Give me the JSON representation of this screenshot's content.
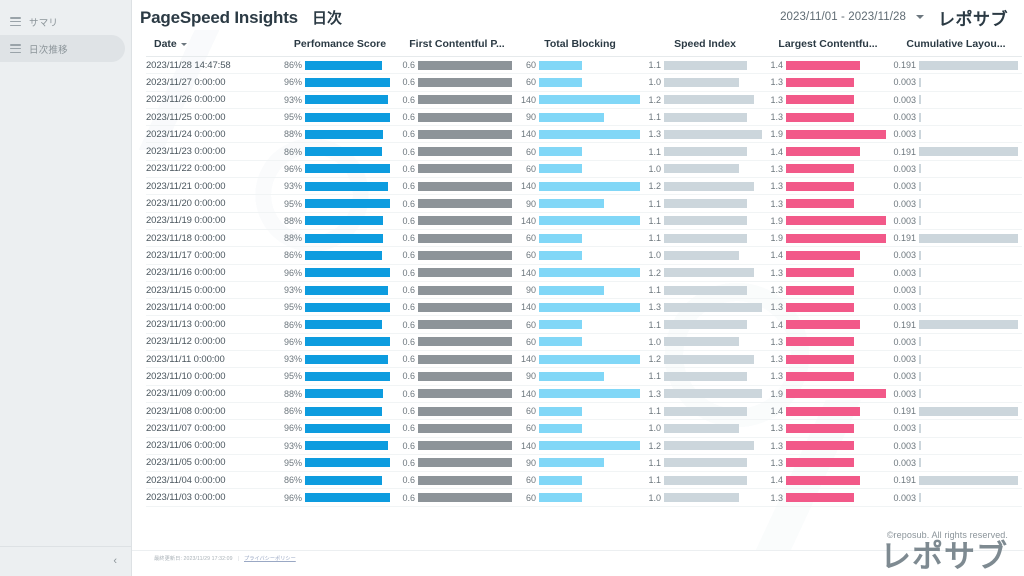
{
  "sidebar": {
    "items": [
      {
        "label": "サマリ",
        "icon": "list-icon",
        "active": false
      },
      {
        "label": "日次推移",
        "icon": "list-icon",
        "active": true
      }
    ],
    "collapse_label": "‹"
  },
  "header": {
    "title": "PageSpeed Insights",
    "subtitle": "日次",
    "date_range": "2023/11/01 - 2023/11/28",
    "brand": "レポサブ"
  },
  "footer": {
    "last_updated": "最終更新日: 2023/11/29 17:32:09",
    "separator": "|",
    "privacy_link": "プライバシーポリシー",
    "copyright": "©reposub. All rights reserved.",
    "brand_big": "レポサブ"
  },
  "colors": {
    "performance_bar": "#0d9cdf",
    "fcp_bar": "#8d9499",
    "tbt_bar": "#81d7f7",
    "speed_index_bar": "#ccd6dc",
    "lcp_bar": "#f25989",
    "cls_bar": "#ccd6dc",
    "sidebar_bg": "#eceff1",
    "sidebar_active": "#dfe3e6",
    "text_dark": "#2b3a44"
  },
  "chart_data": {
    "type": "table",
    "title": "PageSpeed Insights 日次",
    "columns": [
      {
        "key": "date",
        "label": "Date",
        "sortable": true,
        "sort_dir": "desc"
      },
      {
        "key": "perf",
        "label": "Perfomance Score",
        "unit": "%",
        "max": 100,
        "color": "#0d9cdf"
      },
      {
        "key": "fcp",
        "label": "First Contentful P...",
        "unit": "s",
        "max": 0.6,
        "color": "#8d9499"
      },
      {
        "key": "tbt",
        "label": "Total Blocking",
        "unit": "ms",
        "max": 140,
        "color": "#81d7f7"
      },
      {
        "key": "si",
        "label": "Speed Index",
        "unit": "s",
        "max": 1.3,
        "color": "#ccd6dc"
      },
      {
        "key": "lcp",
        "label": "Largest Contentfu...",
        "unit": "s",
        "max": 1.9,
        "color": "#f25989"
      },
      {
        "key": "cls",
        "label": "Cumulative Layou...",
        "unit": "",
        "max": 0.191,
        "color": "#ccd6dc"
      }
    ],
    "rows": [
      {
        "date": "2023/11/28 14:47:58",
        "perf": 86,
        "fcp": 0.6,
        "tbt": 60,
        "si": 1.1,
        "lcp": 1.4,
        "cls": 0.191
      },
      {
        "date": "2023/11/27 0:00:00",
        "perf": 96,
        "fcp": 0.6,
        "tbt": 60,
        "si": 1.0,
        "lcp": 1.3,
        "cls": 0.003
      },
      {
        "date": "2023/11/26 0:00:00",
        "perf": 93,
        "fcp": 0.6,
        "tbt": 140,
        "si": 1.2,
        "lcp": 1.3,
        "cls": 0.003
      },
      {
        "date": "2023/11/25 0:00:00",
        "perf": 95,
        "fcp": 0.6,
        "tbt": 90,
        "si": 1.1,
        "lcp": 1.3,
        "cls": 0.003
      },
      {
        "date": "2023/11/24 0:00:00",
        "perf": 88,
        "fcp": 0.6,
        "tbt": 140,
        "si": 1.3,
        "lcp": 1.9,
        "cls": 0.003
      },
      {
        "date": "2023/11/23 0:00:00",
        "perf": 86,
        "fcp": 0.6,
        "tbt": 60,
        "si": 1.1,
        "lcp": 1.4,
        "cls": 0.191
      },
      {
        "date": "2023/11/22 0:00:00",
        "perf": 96,
        "fcp": 0.6,
        "tbt": 60,
        "si": 1.0,
        "lcp": 1.3,
        "cls": 0.003
      },
      {
        "date": "2023/11/21 0:00:00",
        "perf": 93,
        "fcp": 0.6,
        "tbt": 140,
        "si": 1.2,
        "lcp": 1.3,
        "cls": 0.003
      },
      {
        "date": "2023/11/20 0:00:00",
        "perf": 95,
        "fcp": 0.6,
        "tbt": 90,
        "si": 1.1,
        "lcp": 1.3,
        "cls": 0.003
      },
      {
        "date": "2023/11/19 0:00:00",
        "perf": 88,
        "fcp": 0.6,
        "tbt": 140,
        "si": 1.1,
        "lcp": 1.9,
        "cls": 0.003
      },
      {
        "date": "2023/11/18 0:00:00",
        "perf": 88,
        "fcp": 0.6,
        "tbt": 60,
        "si": 1.1,
        "lcp": 1.9,
        "cls": 0.191
      },
      {
        "date": "2023/11/17 0:00:00",
        "perf": 86,
        "fcp": 0.6,
        "tbt": 60,
        "si": 1.0,
        "lcp": 1.4,
        "cls": 0.003
      },
      {
        "date": "2023/11/16 0:00:00",
        "perf": 96,
        "fcp": 0.6,
        "tbt": 140,
        "si": 1.2,
        "lcp": 1.3,
        "cls": 0.003
      },
      {
        "date": "2023/11/15 0:00:00",
        "perf": 93,
        "fcp": 0.6,
        "tbt": 90,
        "si": 1.1,
        "lcp": 1.3,
        "cls": 0.003
      },
      {
        "date": "2023/11/14 0:00:00",
        "perf": 95,
        "fcp": 0.6,
        "tbt": 140,
        "si": 1.3,
        "lcp": 1.3,
        "cls": 0.003
      },
      {
        "date": "2023/11/13 0:00:00",
        "perf": 86,
        "fcp": 0.6,
        "tbt": 60,
        "si": 1.1,
        "lcp": 1.4,
        "cls": 0.191
      },
      {
        "date": "2023/11/12 0:00:00",
        "perf": 96,
        "fcp": 0.6,
        "tbt": 60,
        "si": 1.0,
        "lcp": 1.3,
        "cls": 0.003
      },
      {
        "date": "2023/11/11 0:00:00",
        "perf": 93,
        "fcp": 0.6,
        "tbt": 140,
        "si": 1.2,
        "lcp": 1.3,
        "cls": 0.003
      },
      {
        "date": "2023/11/10 0:00:00",
        "perf": 95,
        "fcp": 0.6,
        "tbt": 90,
        "si": 1.1,
        "lcp": 1.3,
        "cls": 0.003
      },
      {
        "date": "2023/11/09 0:00:00",
        "perf": 88,
        "fcp": 0.6,
        "tbt": 140,
        "si": 1.3,
        "lcp": 1.9,
        "cls": 0.003
      },
      {
        "date": "2023/11/08 0:00:00",
        "perf": 86,
        "fcp": 0.6,
        "tbt": 60,
        "si": 1.1,
        "lcp": 1.4,
        "cls": 0.191
      },
      {
        "date": "2023/11/07 0:00:00",
        "perf": 96,
        "fcp": 0.6,
        "tbt": 60,
        "si": 1.0,
        "lcp": 1.3,
        "cls": 0.003
      },
      {
        "date": "2023/11/06 0:00:00",
        "perf": 93,
        "fcp": 0.6,
        "tbt": 140,
        "si": 1.2,
        "lcp": 1.3,
        "cls": 0.003
      },
      {
        "date": "2023/11/05 0:00:00",
        "perf": 95,
        "fcp": 0.6,
        "tbt": 90,
        "si": 1.1,
        "lcp": 1.3,
        "cls": 0.003
      },
      {
        "date": "2023/11/04 0:00:00",
        "perf": 86,
        "fcp": 0.6,
        "tbt": 60,
        "si": 1.1,
        "lcp": 1.4,
        "cls": 0.191
      },
      {
        "date": "2023/11/03 0:00:00",
        "perf": 96,
        "fcp": 0.6,
        "tbt": 60,
        "si": 1.0,
        "lcp": 1.3,
        "cls": 0.003
      }
    ]
  }
}
